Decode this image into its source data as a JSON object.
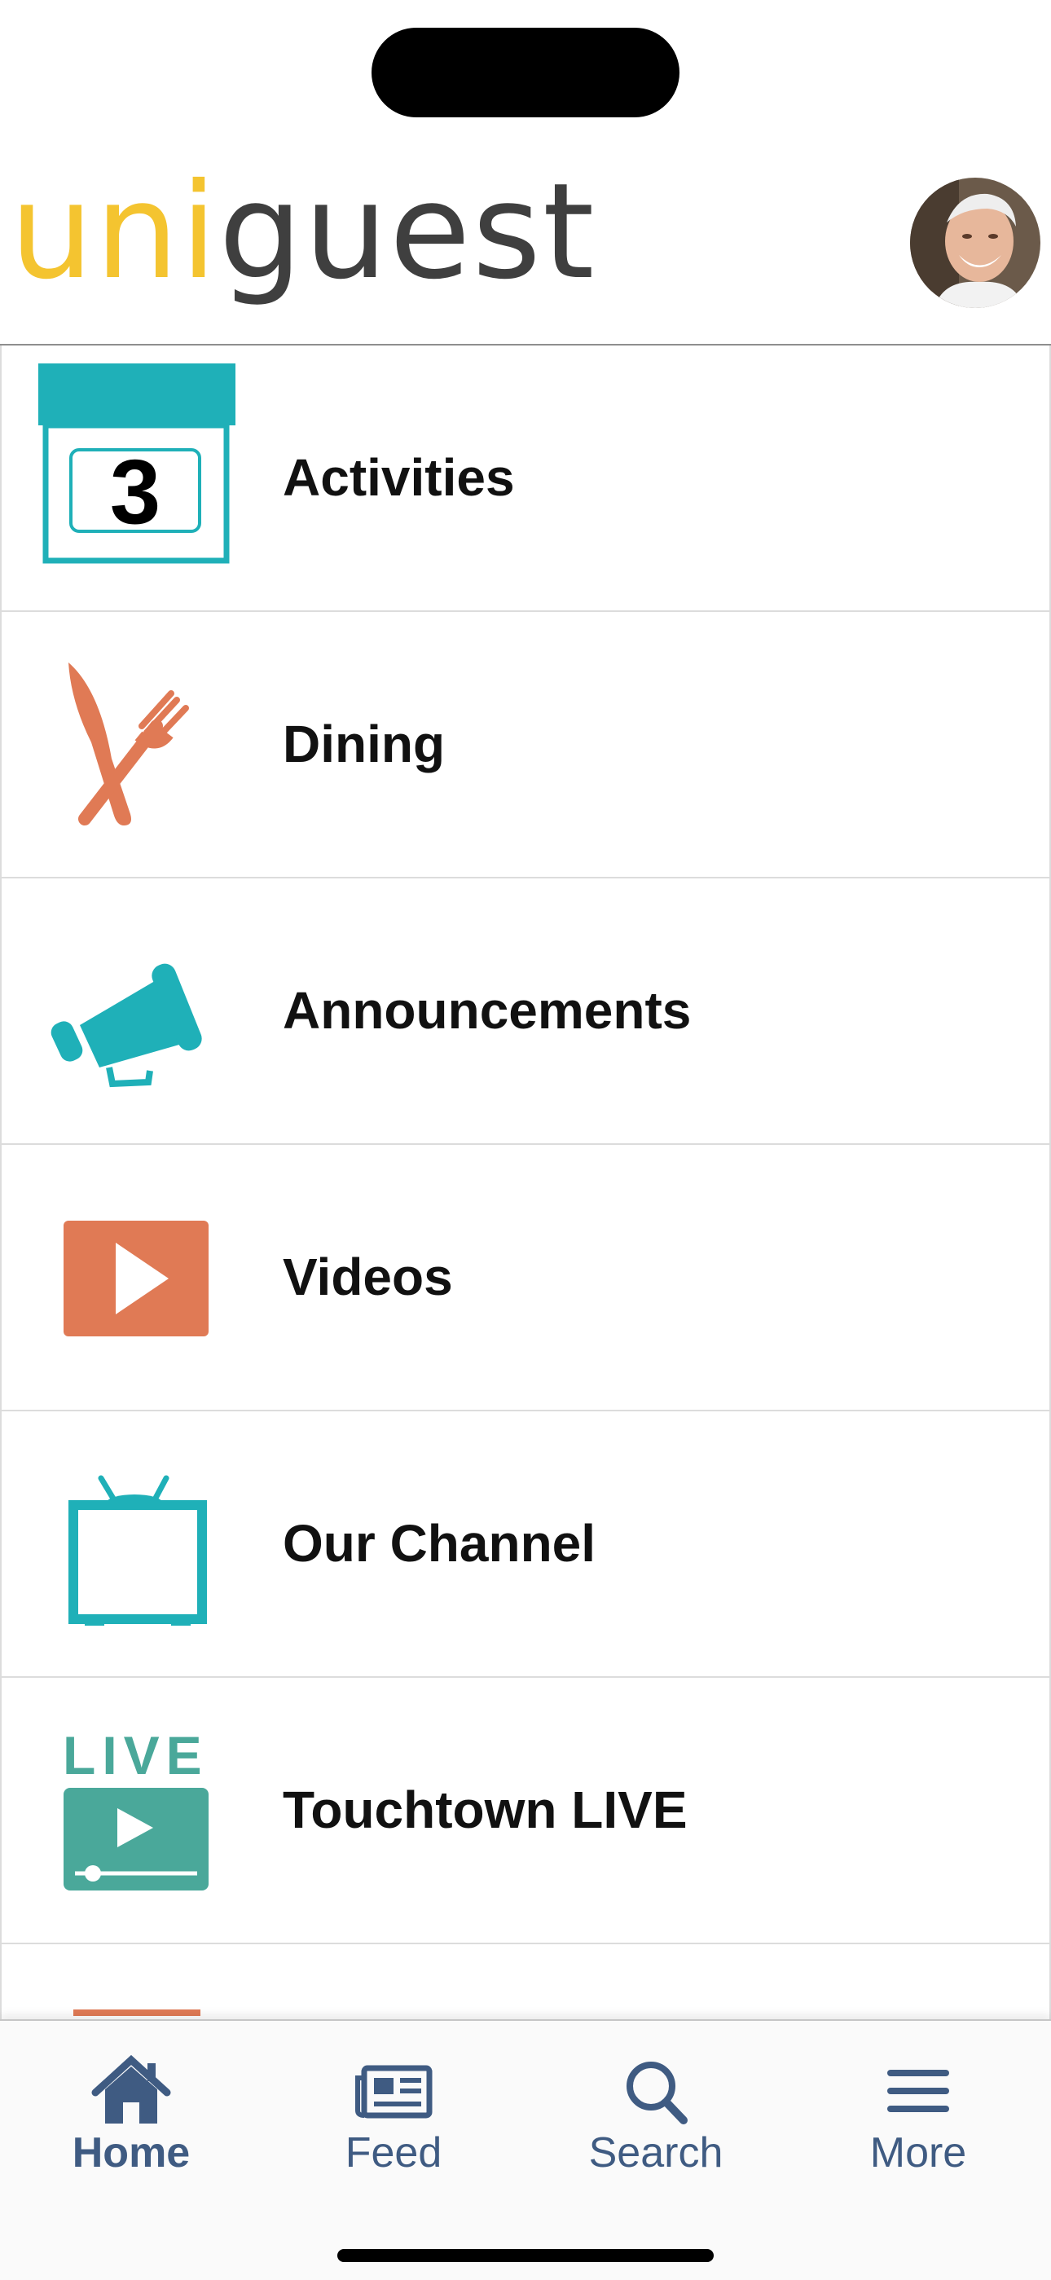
{
  "app": {
    "logo_part1": "uni",
    "logo_part2": "guest",
    "brand_colors": {
      "yellow": "#f4c430",
      "gray": "#3f3f3f",
      "teal": "#1fb0b8",
      "orange": "#e07a55",
      "live_green": "#4aa89a",
      "tab_blue": "#3f5b82"
    }
  },
  "menu": {
    "items": [
      {
        "label": "Activities",
        "icon": "calendar-icon",
        "icon_text": "3"
      },
      {
        "label": "Dining",
        "icon": "fork-knife-icon"
      },
      {
        "label": "Announcements",
        "icon": "megaphone-icon"
      },
      {
        "label": "Videos",
        "icon": "play-icon"
      },
      {
        "label": "Our Channel",
        "icon": "tv-icon"
      },
      {
        "label": "Touchtown LIVE",
        "icon": "live-video-icon",
        "icon_text": "LIVE"
      }
    ]
  },
  "tabbar": {
    "tabs": [
      {
        "label": "Home",
        "icon": "home-icon",
        "active": true
      },
      {
        "label": "Feed",
        "icon": "newspaper-icon",
        "active": false
      },
      {
        "label": "Search",
        "icon": "search-icon",
        "active": false
      },
      {
        "label": "More",
        "icon": "menu-icon",
        "active": false
      }
    ]
  }
}
